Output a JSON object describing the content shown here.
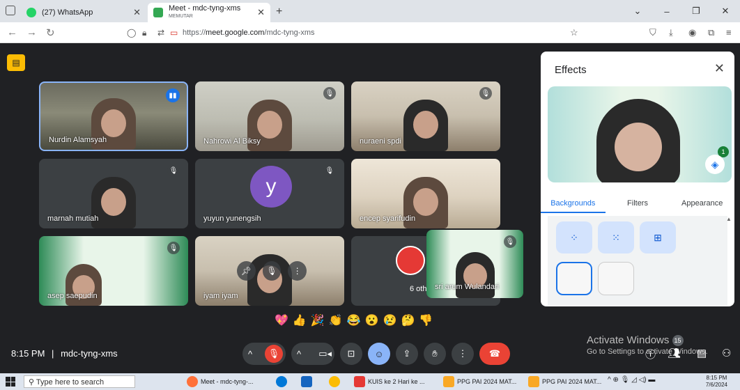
{
  "browser": {
    "tabs": [
      {
        "title": "(27) WhatsApp",
        "subtitle": "",
        "active": false
      },
      {
        "title": "Meet - mdc-tyng-xms",
        "subtitle": "MEMUTAR",
        "active": true
      }
    ],
    "url_prefix": "https://",
    "url_domain": "meet.google.com",
    "url_path": "/mdc-tyng-xms"
  },
  "tiles": [
    {
      "name": "Nurdin Alamsyah",
      "speaking": true
    },
    {
      "name": "Nahrowi Al Biksy"
    },
    {
      "name": "nuraeni spdi"
    },
    {
      "name": "marnah mutiah"
    },
    {
      "name": "yuyun yunengsih",
      "avatar_letter": "y"
    },
    {
      "name": "encep syarifudin"
    },
    {
      "name": "asep saepudin"
    },
    {
      "name": "iyam iyam"
    },
    {
      "name": "6 others"
    }
  ],
  "self_tile": {
    "name": "sri arum Wulandari"
  },
  "reactions": [
    "💖",
    "👍",
    "🎉",
    "👏",
    "😂",
    "😮",
    "😢",
    "🤔",
    "👎"
  ],
  "meeting_info": {
    "time": "8:15 PM",
    "separator": "|",
    "code": "mdc-tyng-xms"
  },
  "activate_windows": {
    "line1": "Activate Windows",
    "badge": "15",
    "line2": "Go to Settings to activate Windows."
  },
  "effects_panel": {
    "title": "Effects",
    "tabs": [
      "Backgrounds",
      "Filters",
      "Appearance"
    ],
    "selected_tab": "Backgrounds",
    "layer_count": "1"
  },
  "taskbar": {
    "search_placeholder": "Type here to search",
    "items": [
      "Meet - mdc-tyng-...",
      "KUIS  ke 2 Hari ke ...",
      "PPG PAI 2024 MAT...",
      "PPG PAI 2024 MAT..."
    ],
    "time": "8:15 PM",
    "date": "7/6/2024"
  },
  "colors": {
    "meet_bg": "#202124",
    "accent": "#1a73e8",
    "end_call": "#ea4335",
    "caption_toggle": "#fbbc04"
  }
}
